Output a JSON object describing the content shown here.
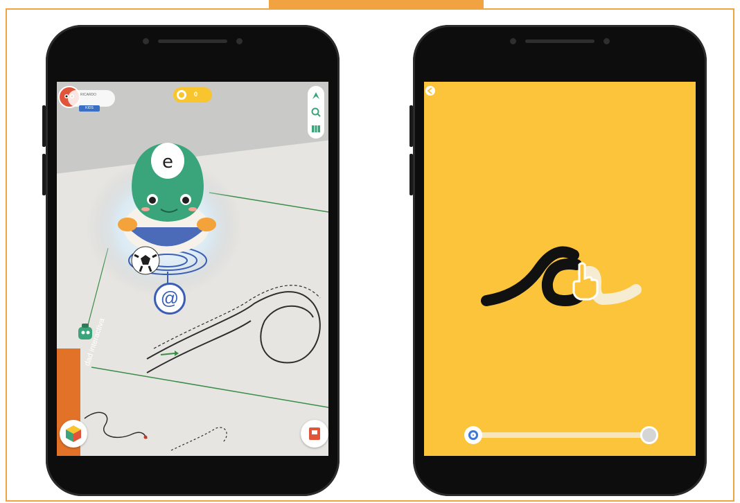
{
  "header_tab": {
    "label": ""
  },
  "left_phone": {
    "user": {
      "name": "RICARDO",
      "badge": "KIDS"
    },
    "coins": {
      "count": "0"
    },
    "toolbar": {
      "icons": [
        "compass-icon",
        "search-icon",
        "map-icon"
      ]
    },
    "book_strip": {
      "text": "dad interactiva"
    },
    "bottom_left_button": {
      "icon": "cube-icon"
    },
    "bottom_right_button": {
      "icon": "card-icon"
    },
    "character": {
      "icon": "letter-e-icon"
    },
    "marker": {
      "icon": "at-sign-icon",
      "text": "@"
    }
  },
  "right_phone": {
    "back_button": {
      "icon": "back-arrow-icon"
    },
    "progress": {
      "value": 0.0
    },
    "hand_icon": "hand-pointer-icon"
  },
  "colors": {
    "accent": "#f0a340",
    "yellow": "#fbc43b",
    "blue": "#3c78d8",
    "green": "#3aa57a",
    "orange": "#e27228"
  }
}
